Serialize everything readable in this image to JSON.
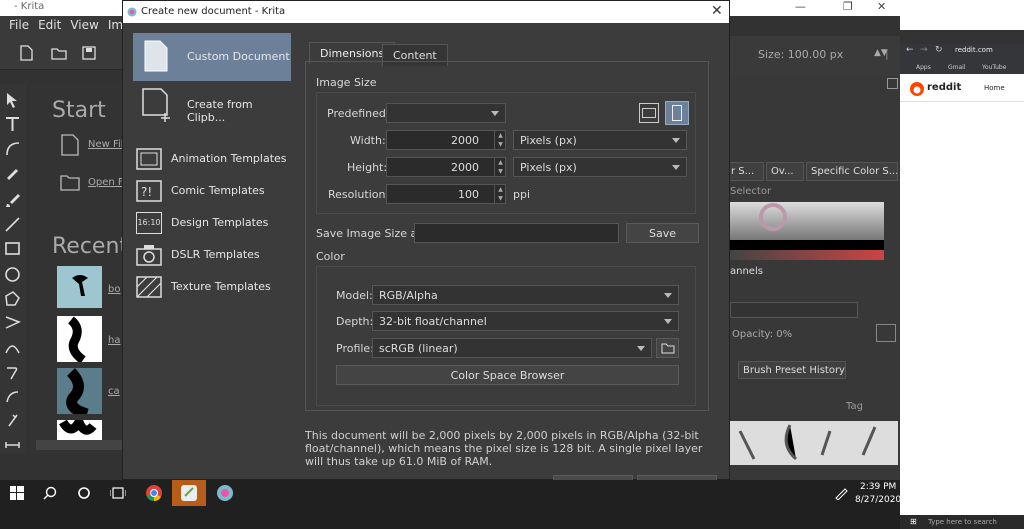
{
  "krita": {
    "title": "- Krita",
    "menu": [
      "File",
      "Edit",
      "View",
      "Im"
    ],
    "welcome": {
      "start": "Start",
      "new_file": "New Fil",
      "open_file": "Open F",
      "recent": "Recent",
      "recent_items": [
        "bo",
        "ha",
        "ca"
      ]
    },
    "size_label": "Size: 100.00 px",
    "dockers": {
      "tabs": [
        "r S...",
        "Ov...",
        "Specific Color S..."
      ],
      "selector": "Selector",
      "channels": "annels",
      "opacity": "Opacity:  0%",
      "brush_history": "Brush Preset History",
      "tag": "Tag"
    }
  },
  "dialog": {
    "title": "Create new document - Krita",
    "templates": [
      {
        "label": "Custom Document",
        "icon": "document-icon"
      },
      {
        "label": "Create from Clipb...",
        "icon": "clipboard-add-icon"
      },
      {
        "label": "Animation Templates",
        "icon": "film-icon"
      },
      {
        "label": "Comic Templates",
        "icon": "speech-bubble-icon"
      },
      {
        "label": "Design Templates",
        "icon": "design-1610-icon",
        "badge": "16:10"
      },
      {
        "label": "DSLR Templates",
        "icon": "camera-icon"
      },
      {
        "label": "Texture Templates",
        "icon": "texture-icon"
      }
    ],
    "tabs": [
      "Dimensions",
      "Content"
    ],
    "image_size": "Image Size",
    "predefined_label": "Predefined:",
    "width_label": "Width:",
    "width_value": "2000",
    "width_unit": "Pixels (px)",
    "height_label": "Height:",
    "height_value": "2000",
    "height_unit": "Pixels (px)",
    "resolution_label": "Resolution:",
    "resolution_value": "100",
    "resolution_unit": "ppi",
    "save_size_label": "Save Image Size as:",
    "save_button": "Save",
    "color_section": "Color",
    "model_label": "Model:",
    "model_value": "RGB/Alpha",
    "depth_label": "Depth:",
    "depth_value": "32-bit float/channel",
    "profile_label": "Profile:",
    "profile_value": "scRGB (linear)",
    "color_space_browser": "Color Space Browser",
    "description": "This document will be 2,000 pixels by 2,000 pixels in RGB/Alpha (32-bit float/channel), which means the pixel size is 128 bit. A single pixel layer will thus take up 61.0 MiB of RAM."
  },
  "browser": {
    "url": "reddit.com",
    "bookmarks": [
      "Apps",
      "Gmail",
      "YouTube"
    ],
    "brand": "reddit",
    "home": "Home",
    "search_placeholder": "Type here to search"
  },
  "taskbar": {
    "time": "2:39 PM",
    "date": "8/27/2020"
  },
  "colors": {
    "selected_template": "#6d8099",
    "dialog_bg": "#3c3c3c",
    "taskbar": "#202020",
    "reddit": "#ff4500"
  }
}
